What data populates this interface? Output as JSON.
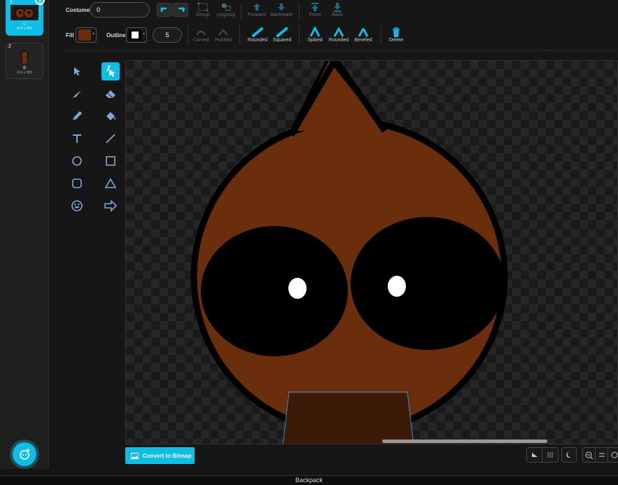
{
  "costumes": [
    {
      "number": "1",
      "name": "0",
      "size": "476 x 406",
      "selected": true
    },
    {
      "number": "2",
      "name": "8",
      "size": "214 x 305",
      "selected": false
    }
  ],
  "costume_bar": {
    "costume_label": "Costume",
    "costume_name": "0",
    "undo_icon": "undo-icon",
    "redo_icon": "redo-icon",
    "group": "Group",
    "ungroup": "Ungroup",
    "forward": "Forward",
    "backward": "Backward",
    "front": "Front",
    "back": "Back"
  },
  "style_bar": {
    "fill_label": "Fill",
    "fill_color": "#6b2e0c",
    "outline_label": "Outline",
    "outline_color": "#ffffff",
    "outline_width": "5",
    "curved": "Curved",
    "pointed": "Pointed",
    "rounded": "Rounded",
    "squared": "Squared",
    "spiked": "Spiked",
    "rounded_join": "Rounded",
    "beveled": "Beveled",
    "delete": "Delete"
  },
  "tools": [
    "select-tool",
    "reshape-tool",
    "brush-tool",
    "eraser-tool",
    "eyedropper-tool",
    "fill-tool",
    "text-tool",
    "line-tool",
    "circle-tool",
    "rectangle-tool",
    "rounded-rectangle-tool",
    "triangle-tool",
    "emoji-tool",
    "arrow-tool"
  ],
  "convert_button": "Convert to Bitmap",
  "backpack": "Backpack",
  "colors": {
    "accent": "#0fbde5",
    "face": "#6b2e0c",
    "stroke": "#000000"
  }
}
